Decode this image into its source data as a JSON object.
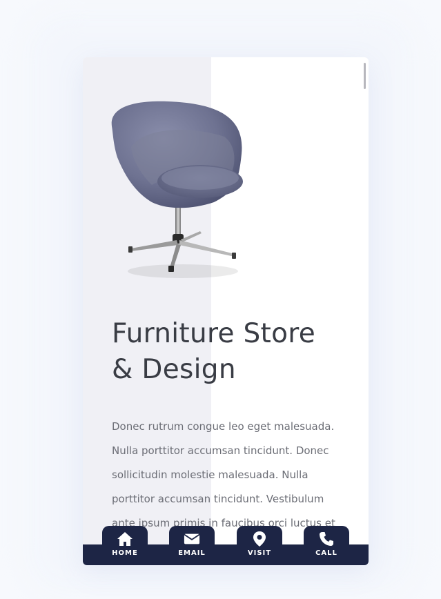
{
  "hero": {
    "title_line1": "Furniture Store",
    "title_line2": "& Design",
    "body": "Donec rutrum congue leo eget malesuada. Nulla porttitor accumsan tincidunt. Donec sollicitudin molestie malesuada. Nulla porttitor accumsan tincidunt. Vestibulum ante ipsum primis in faucibus orci luctus et"
  },
  "nav": {
    "items": [
      {
        "label": "HOME",
        "icon": "home-icon"
      },
      {
        "label": "EMAIL",
        "icon": "envelope-icon"
      },
      {
        "label": "VISIT",
        "icon": "map-pin-icon"
      },
      {
        "label": "CALL",
        "icon": "phone-icon"
      }
    ]
  },
  "colors": {
    "nav_background": "#1d2545",
    "panel_left": "#f0f0f5",
    "title_text": "#393c44",
    "body_text": "#6b6d75"
  }
}
